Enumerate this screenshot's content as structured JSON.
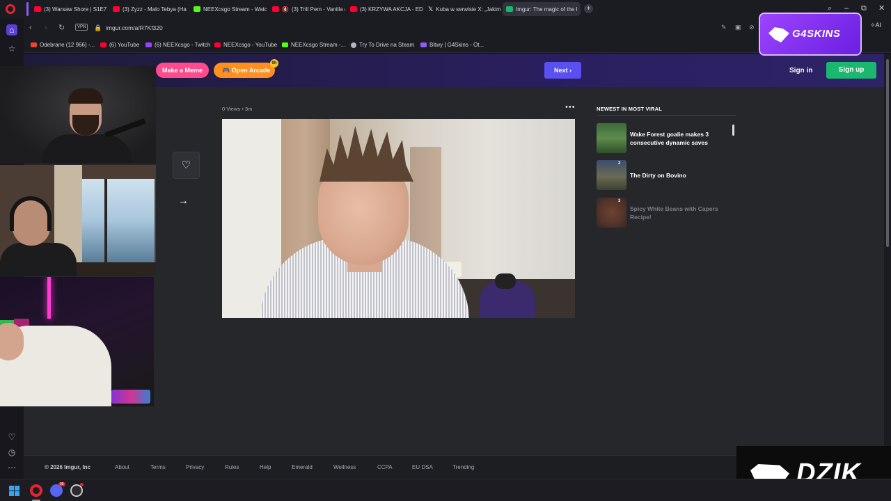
{
  "browser": {
    "tabs": [
      {
        "label": "(3) Warsaw Shore | S1E7 (",
        "favicon": "youtube"
      },
      {
        "label": "(3) Zyzz - Malo Tebya (Ha",
        "favicon": "youtube"
      },
      {
        "label": "NEEXcsgo Stream - Watch",
        "favicon": "kick"
      },
      {
        "label": "(3) Trill Pem - Vanilla (",
        "favicon": "youtube"
      },
      {
        "label": "(3) KRZYWA AKCJA - EDU",
        "favicon": "youtube"
      },
      {
        "label": "Kuba w serwisie X: „Jakim",
        "favicon": "x"
      },
      {
        "label": "Imgur: The magic of the I",
        "favicon": "imgur"
      }
    ],
    "new_tab": "+",
    "address": {
      "vpn": "VPN",
      "url": "imgur.com/a/R7Kf320"
    },
    "ai_button": "AI",
    "bookmarks": [
      {
        "label": "Odebrane (12 966) -...",
        "favicon": "gmail"
      },
      {
        "label": "(6) YouTube",
        "favicon": "youtube"
      },
      {
        "label": "(6) NEEXcsgo - Twitch",
        "favicon": "twitch"
      },
      {
        "label": "NEEXcsgo - YouTube",
        "favicon": "youtube"
      },
      {
        "label": "NEEXcsgo Stream -...",
        "favicon": "kick"
      },
      {
        "label": "Try To Drive na Steam",
        "favicon": "steam"
      },
      {
        "label": "Bitwy | G4Skins - Ot...",
        "favicon": "g4skins"
      }
    ]
  },
  "imgur": {
    "header": {
      "make_meme": "Make a Meme",
      "open_arcade": "Open Arcade",
      "arcade_badge": "9h",
      "next": "Next",
      "sign_in": "Sign in",
      "sign_up": "Sign up"
    },
    "post": {
      "views": "0 Views",
      "age": "3m",
      "menu": "•••"
    },
    "viral": {
      "title": "NEWEST IN MOST VIRAL",
      "items": [
        {
          "title": "Wake Forest goalie makes 3 consecutive dynamic saves",
          "rank": ""
        },
        {
          "title": "The Dirty on Bovino",
          "rank": "2"
        },
        {
          "title": "Spicy White Beans with Capers Recipe!",
          "rank": "3"
        }
      ]
    },
    "footer": {
      "copyright": "© 2026 Imgur, Inc",
      "links": [
        "About",
        "Terms",
        "Privacy",
        "Rules",
        "Help",
        "Emerald",
        "Wellness",
        "CCPA",
        "EU DSA",
        "Trending"
      ]
    }
  },
  "overlays": {
    "sponsor_top": "G4SKINS",
    "sponsor_bottom": "DZIK"
  },
  "taskbar": {
    "discord_badge": "99"
  },
  "colors": {
    "imgur_green": "#1bb76e",
    "next_button": "#5a4ff0",
    "meme_button": "#ff4a8d",
    "arcade_button": "#ff8f1f",
    "g4skins_purple": "#9d44ff"
  }
}
